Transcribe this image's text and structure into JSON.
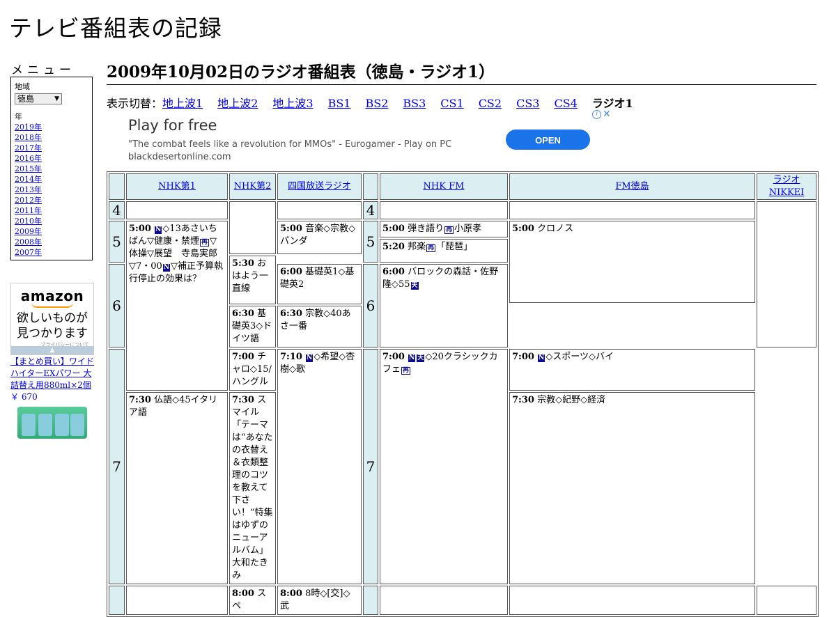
{
  "site_title": "テレビ番組表の記録",
  "menu": {
    "heading": "メニュー",
    "region_label": "地域",
    "region_value": "徳島",
    "year_label": "年",
    "years": [
      "2019年",
      "2018年",
      "2017年",
      "2016年",
      "2015年",
      "2014年",
      "2013年",
      "2012年",
      "2011年",
      "2010年",
      "2009年",
      "2008年",
      "2007年"
    ]
  },
  "left_ad": {
    "logo": "amazon",
    "text": "欲しいものが見つかります",
    "privacy": "プライバシーについて",
    "product_title": "【まとめ買い】ワイドハイターEXパワー 大詰替え用880ml×2個",
    "product_price": "￥ 670"
  },
  "page_title": "2009年10月02日のラジオ番組表（徳島・ラジオ1）",
  "switcher": {
    "label": "表示切替：",
    "links": [
      "地上波1",
      "地上波2",
      "地上波3",
      "BS1",
      "BS2",
      "BS3",
      "CS1",
      "CS2",
      "CS3",
      "CS4"
    ],
    "current": "ラジオ1"
  },
  "ad": {
    "headline": "Play for free",
    "description": "\"The combat feels like a revolution for MMOs\" - Eurogamer - Play on PC",
    "domain": "blackdesertonline.com",
    "button": "OPEN",
    "info_icon": "i",
    "close_icon": "✕"
  },
  "markers": {
    "news": "N",
    "rerun": "再",
    "weather": "天"
  },
  "schedule": {
    "channels": [
      "NHK第1",
      "NHK第2",
      "四国放送ラジオ",
      "NHK FM",
      "FM徳島",
      "ラジオNIKKEI"
    ],
    "hours": [
      "4",
      "5",
      "6",
      "7"
    ],
    "programs": {
      "nhk1_500_time": "5:00",
      "nhk1_500_title": "◇13あさいちばん▽健康・禁煙",
      "nhk1_500_title2": "▽体操▽展望　寺島実郎▽7・00",
      "nhk1_500_title3": "▽補正予算執行停止の効果は？",
      "nhk2_600_time": "6:00",
      "nhk2_600_title": "基礎英1◇基礎英2",
      "nhk2_630_time": "6:30",
      "nhk2_630_title": "基礎英3◇ドイツ語",
      "nhk2_700_time": "7:00",
      "nhk2_700_title": "チャロ◇15/ハングル",
      "nhk2_730_time": "7:30",
      "nhk2_730_title": "仏語◇45イタリア語",
      "nhk2_800_time": "8:00",
      "nhk2_800_title": "スペ",
      "shikoku_500_time": "5:00",
      "shikoku_500_title": "音楽◇宗教◇パンダ",
      "shikoku_530_time": "5:30",
      "shikoku_530_title": "おはよう一直線",
      "shikoku_630_time": "6:30",
      "shikoku_630_title": "宗教◇40あさ一番",
      "shikoku_710_time": "7:10",
      "shikoku_710_title": "◇希望◇杏樹◇歌",
      "shikoku_800_time": "8:00",
      "shikoku_800_title": "8時◇[交]◇武",
      "fm_500_time": "5:00",
      "fm_500_title": "弾き語り",
      "fm_500_title2": "小原孝",
      "fm_520_time": "5:20",
      "fm_520_title": "邦楽",
      "fm_520_title2": "「琵琶」",
      "fm_600_time": "6:00",
      "fm_600_title": "バロックの森話・佐野隆◇55",
      "fm_700_time": "7:00",
      "fm_700_title": "◇20クラシックカフェ",
      "fmt_500_time": "5:00",
      "fmt_500_title": "クロノス",
      "fmt_700_time": "7:00",
      "fmt_700_title": "◇スポーツ◇バイ",
      "fmt_730_time": "7:30",
      "fmt_730_title": "スマイル「テーマは“あなたの衣替え＆衣類整理のコツを教えて下さい！”特集はゆずのニューアルバム」大和たきみ",
      "nikkei_730_time": "7:30",
      "nikkei_730_title": "宗教◇紀野◇経済"
    }
  }
}
